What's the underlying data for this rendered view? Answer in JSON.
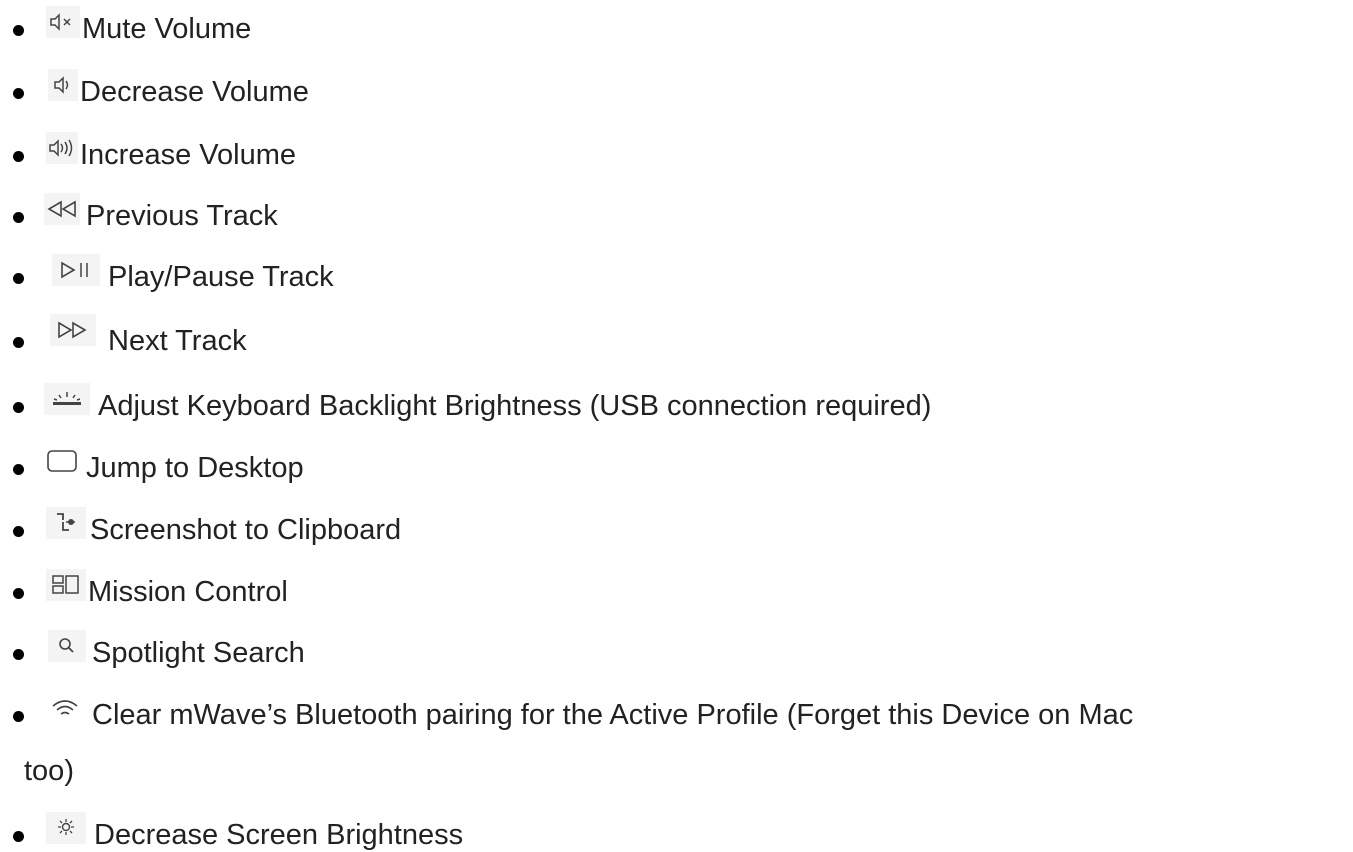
{
  "shortcuts": [
    {
      "icon": "mute-volume-icon",
      "label": "Mute Volume"
    },
    {
      "icon": "decrease-volume-icon",
      "label": "Decrease Volume"
    },
    {
      "icon": "increase-volume-icon",
      "label": "Increase Volume"
    },
    {
      "icon": "previous-track-icon",
      "label": "Previous Track"
    },
    {
      "icon": "play-pause-icon",
      "label": "Play/Pause Track"
    },
    {
      "icon": "next-track-icon",
      "label": "Next Track"
    },
    {
      "icon": "keyboard-backlight-icon",
      "label": "Adjust Keyboard Backlight Brightness (USB connection required)"
    },
    {
      "icon": "desktop-icon",
      "label": "Jump to Desktop"
    },
    {
      "icon": "screenshot-icon",
      "label": "Screenshot to Clipboard"
    },
    {
      "icon": "mission-control-icon",
      "label": "Mission Control"
    },
    {
      "icon": "search-icon",
      "label": "Spotlight Search"
    },
    {
      "icon": "bluetooth-wave-icon",
      "label": "Clear mWave’s Bluetooth pairing for the Active Profile (Forget this Device on Mac",
      "label_cont": "too)"
    },
    {
      "icon": "screen-brightness-icon",
      "label": "Decrease Screen Brightness"
    }
  ]
}
